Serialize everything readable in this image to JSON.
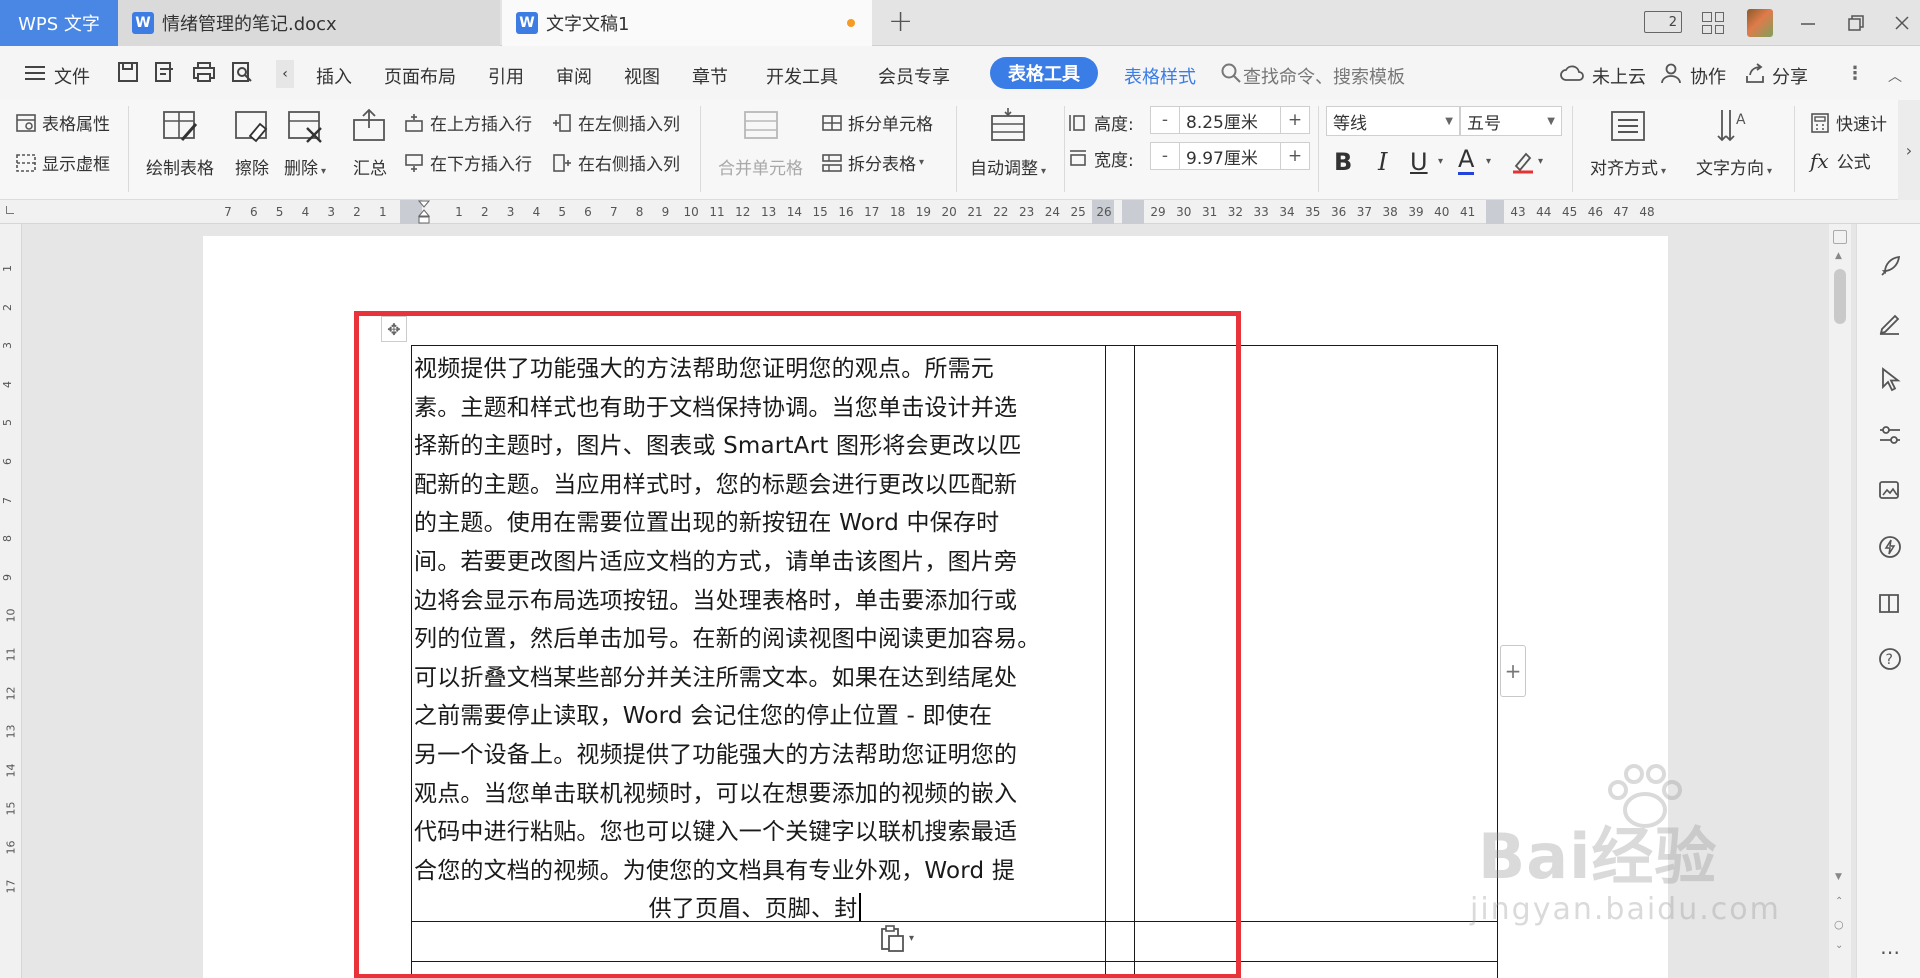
{
  "tabs": {
    "brand": "WPS 文字",
    "doc1": "情绪管理的笔记.docx",
    "doc2": "文字文稿1",
    "new_tab": "+",
    "window_badge": "2"
  },
  "menu": {
    "file": "文件",
    "items": [
      "插入",
      "页面布局",
      "引用",
      "审阅",
      "视图",
      "章节",
      "开发工具",
      "会员专享"
    ],
    "active_tab": "表格工具",
    "table_style": "表格样式",
    "search": "查找命令、搜索模板",
    "cloud": "未上云",
    "collab": "协作",
    "share": "分享"
  },
  "ribbon": {
    "table_props": "表格属性",
    "show_grid": "显示虚框",
    "draw_table": "绘制表格",
    "erase": "擦除",
    "delete": "删除",
    "summary": "汇总",
    "insert_above": "在上方插入行",
    "insert_below": "在下方插入行",
    "insert_left": "在左侧插入列",
    "insert_right": "在右侧插入列",
    "merge_cells": "合并单元格",
    "split_cells": "拆分单元格",
    "split_table": "拆分表格",
    "auto_fit": "自动调整",
    "height_label": "高度:",
    "height_value": "8.25厘米",
    "width_label": "宽度:",
    "width_value": "9.97厘米",
    "minus": "-",
    "plus": "+",
    "font_name": "等线",
    "font_size": "五号",
    "bold": "B",
    "italic": "I",
    "underline": "U",
    "font_color": "A",
    "align": "对齐方式",
    "text_dir": "文字方向",
    "quick_calc": "快速计",
    "formula": "公式",
    "formula_glyph": "fx"
  },
  "ruler": {
    "left_numbers": [
      "7",
      "6",
      "5",
      "4",
      "3",
      "2",
      "1"
    ],
    "right_numbers": [
      "1",
      "2",
      "3",
      "4",
      "5",
      "6",
      "7",
      "8",
      "9",
      "10",
      "11",
      "12",
      "13",
      "14",
      "15",
      "16",
      "17",
      "18",
      "19",
      "20",
      "21",
      "22",
      "23",
      "24",
      "25",
      "26"
    ],
    "far_numbers": [
      "29",
      "30",
      "31",
      "32",
      "33",
      "34",
      "35",
      "36",
      "37",
      "38",
      "39",
      "40",
      "41"
    ],
    "end_numbers": [
      "43",
      "44",
      "45",
      "46",
      "47",
      "48"
    ],
    "vertical": [
      "1",
      "2",
      "3",
      "4",
      "5",
      "6",
      "7",
      "8",
      "9",
      "10",
      "11",
      "12",
      "13",
      "14",
      "15",
      "16",
      "17"
    ]
  },
  "document": {
    "lines": [
      "视频提供了功能强大的方法帮助您证明您的观点。所需元",
      "素。主题和样式也有助于文档保持协调。当您单击设计并选",
      "择新的主题时，图片、图表或 SmartArt 图形将会更改以匹",
      "配新的主题。当应用样式时，您的标题会进行更改以匹配新",
      "的主题。使用在需要位置出现的新按钮在 Word 中保存时",
      "间。若要更改图片适应文档的方式，请单击该图片，图片旁",
      "边将会显示布局选项按钮。当处理表格时，单击要添加行或",
      "列的位置，然后单击加号。在新的阅读视图中阅读更加容易。",
      "可以折叠文档某些部分并关注所需文本。如果在达到结尾处",
      "之前需要停止读取，Word 会记住您的停止位置 - 即使在",
      "另一个设备上。视频提供了功能强大的方法帮助您证明您的",
      "观点。当您单击联机视频时，可以在想要添加的视频的嵌入",
      "代码中进行粘贴。您也可以键入一个关键字以联机搜索最适",
      "合您的文档的视频。为使您的文档具有专业外观，Word 提",
      "供了页眉、页脚、封"
    ]
  },
  "watermark": {
    "main": "Bai经验",
    "sub": "jingyan.baidu.com"
  },
  "colors": {
    "accent": "#3b7de6",
    "highlight_box": "#e8333a",
    "brand_tab": "#4a87e5"
  }
}
